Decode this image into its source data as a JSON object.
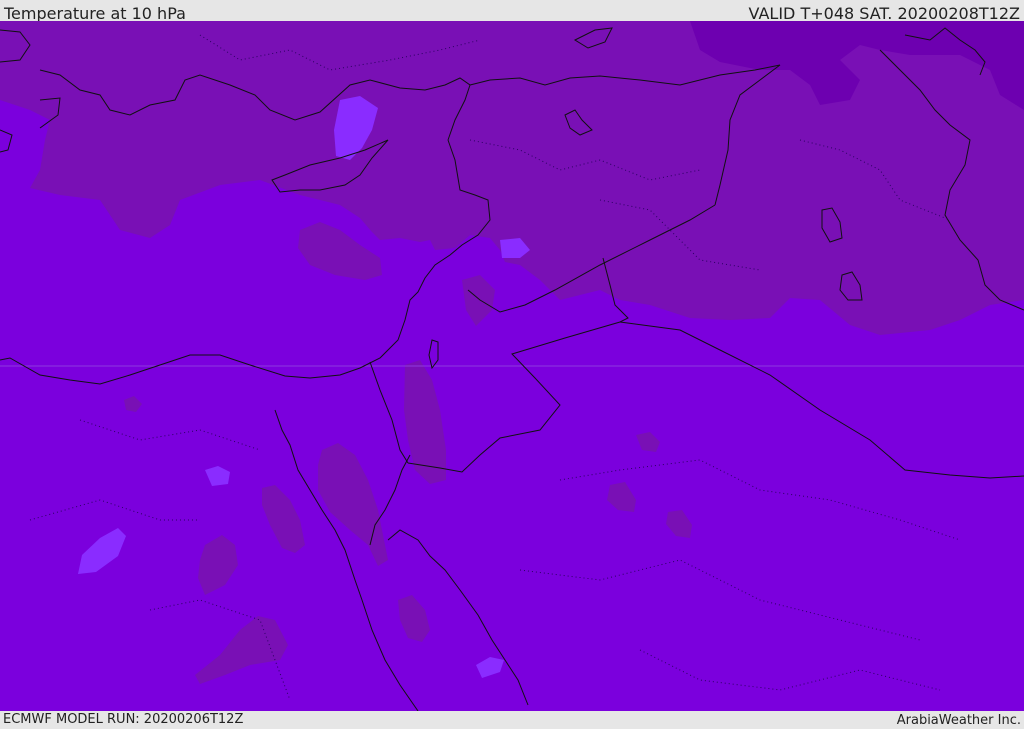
{
  "header": {
    "title": "Temperature at 10 hPa",
    "valid": "VALID T+048 SAT. 20200208T12Z"
  },
  "footer": {
    "model_run": "ECMWF MODEL RUN: 20200206T12Z",
    "brand": "ArabiaWeather Inc."
  },
  "map": {
    "fill_colors": {
      "base": "#7b00dd",
      "warm": "#7910b5",
      "warmer": "#6d00b0",
      "cold": "#8a2cff"
    }
  }
}
